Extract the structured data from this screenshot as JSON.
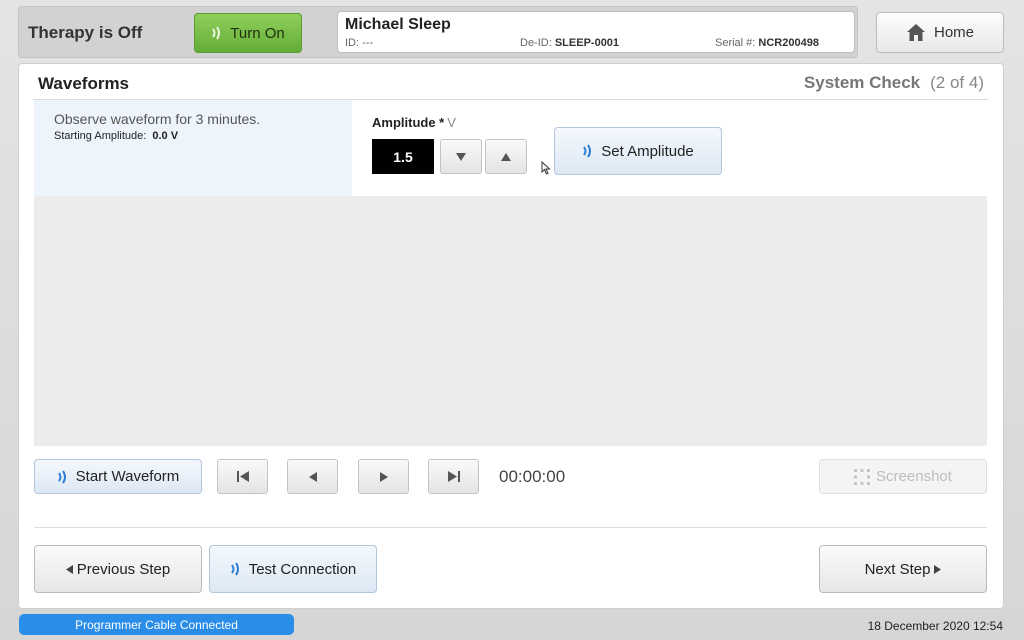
{
  "header": {
    "therapy_status": "Therapy is Off",
    "turn_on_label": "Turn On",
    "patient": {
      "name": "Michael Sleep",
      "id_label": "ID:",
      "id_value": "---",
      "deid_label": "De-ID:",
      "deid_value": "SLEEP-0001",
      "serial_label": "Serial #:",
      "serial_value": "NCR200498"
    },
    "home_label": "Home"
  },
  "panel": {
    "title": "Waveforms",
    "system_check_label": "System Check",
    "system_check_step": "(2 of 4)",
    "instruction": "Observe waveform for 3 minutes.",
    "starting_amplitude_label": "Starting Amplitude:",
    "starting_amplitude_value": "0.0 V",
    "amplitude": {
      "label": "Amplitude *",
      "unit": "V",
      "value": "1.5",
      "decrease_icon": "triangle-down-icon",
      "increase_icon": "triangle-up-icon",
      "set_label": "Set Amplitude"
    },
    "controls": {
      "start_waveform_label": "Start Waveform",
      "time": "00:00:00",
      "screenshot_label": "Screenshot"
    },
    "footer": {
      "previous_label": "Previous Step",
      "test_connection_label": "Test Connection",
      "next_label": "Next Step"
    }
  },
  "statusbar": {
    "cable_status": "Programmer Cable Connected",
    "datetime": "18 December 2020 12:54"
  },
  "colors": {
    "turn_on_green": "#74b944",
    "status_blue": "#2a8de8",
    "amplitude_box": "#000000",
    "instruction_bg": "#eef4fb",
    "wireless_icon": "#2c7fd6"
  }
}
